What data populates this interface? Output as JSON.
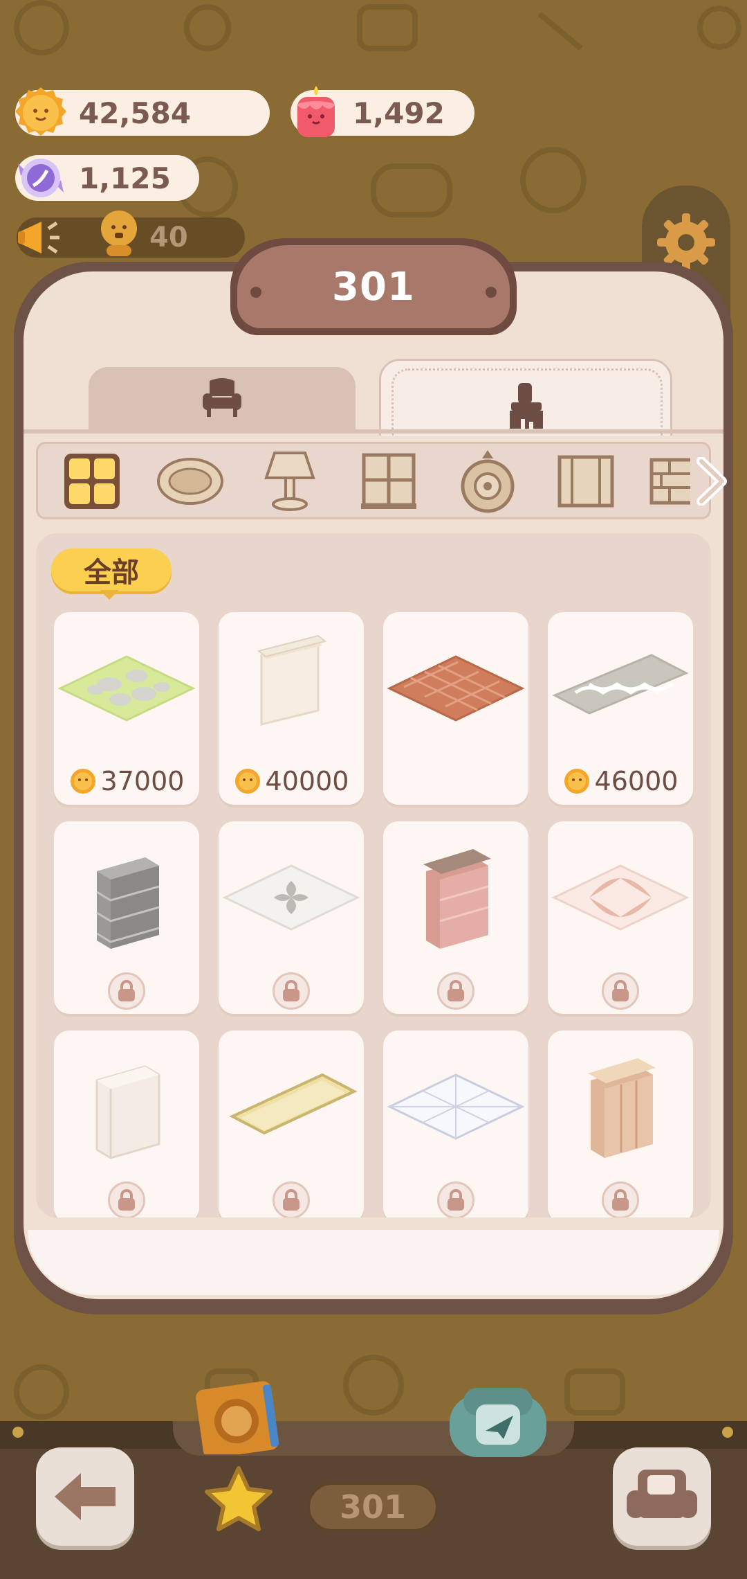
{
  "currencies": {
    "coins": "42,584",
    "candles": "1,492",
    "gems": "1,125"
  },
  "notice": {
    "count": "40"
  },
  "room": {
    "number": "301"
  },
  "tabs": [
    {
      "icon": "armchair-icon",
      "selected": false
    },
    {
      "icon": "paint-brush-icon",
      "selected": true
    }
  ],
  "categories": [
    {
      "icon": "all-grid-icon",
      "selected": true
    },
    {
      "icon": "rug-icon",
      "selected": false
    },
    {
      "icon": "lamp-icon",
      "selected": false
    },
    {
      "icon": "window-icon",
      "selected": false
    },
    {
      "icon": "wall-clock-icon",
      "selected": false
    },
    {
      "icon": "cabinet-icon",
      "selected": false
    },
    {
      "icon": "brick-wall-icon",
      "selected": false
    }
  ],
  "filter": {
    "label": "全部"
  },
  "items": [
    {
      "kind": "grass-stone-floor",
      "price": "37000",
      "locked": false
    },
    {
      "kind": "cream-wall",
      "price": "40000",
      "locked": false
    },
    {
      "kind": "brick-floor",
      "price": "",
      "locked": false
    },
    {
      "kind": "lattice-rug",
      "price": "46000",
      "locked": false
    },
    {
      "kind": "gray-brick-wall",
      "price": "",
      "locked": true
    },
    {
      "kind": "white-tile-floor",
      "price": "",
      "locked": true
    },
    {
      "kind": "pink-brick-wall",
      "price": "",
      "locked": true
    },
    {
      "kind": "pink-pattern-floor",
      "price": "",
      "locked": true
    },
    {
      "kind": "white-wall",
      "price": "",
      "locked": true
    },
    {
      "kind": "yellow-mat-floor",
      "price": "",
      "locked": true
    },
    {
      "kind": "white-marble-floor",
      "price": "",
      "locked": true
    },
    {
      "kind": "wood-panel-wall",
      "price": "",
      "locked": true
    }
  ],
  "bottom": {
    "counter": "301"
  },
  "colors": {
    "background": "#8a6b33",
    "panel": "#f0e0d3",
    "accent_yellow": "#fbcf4f",
    "price_text": "#6e4d44"
  }
}
